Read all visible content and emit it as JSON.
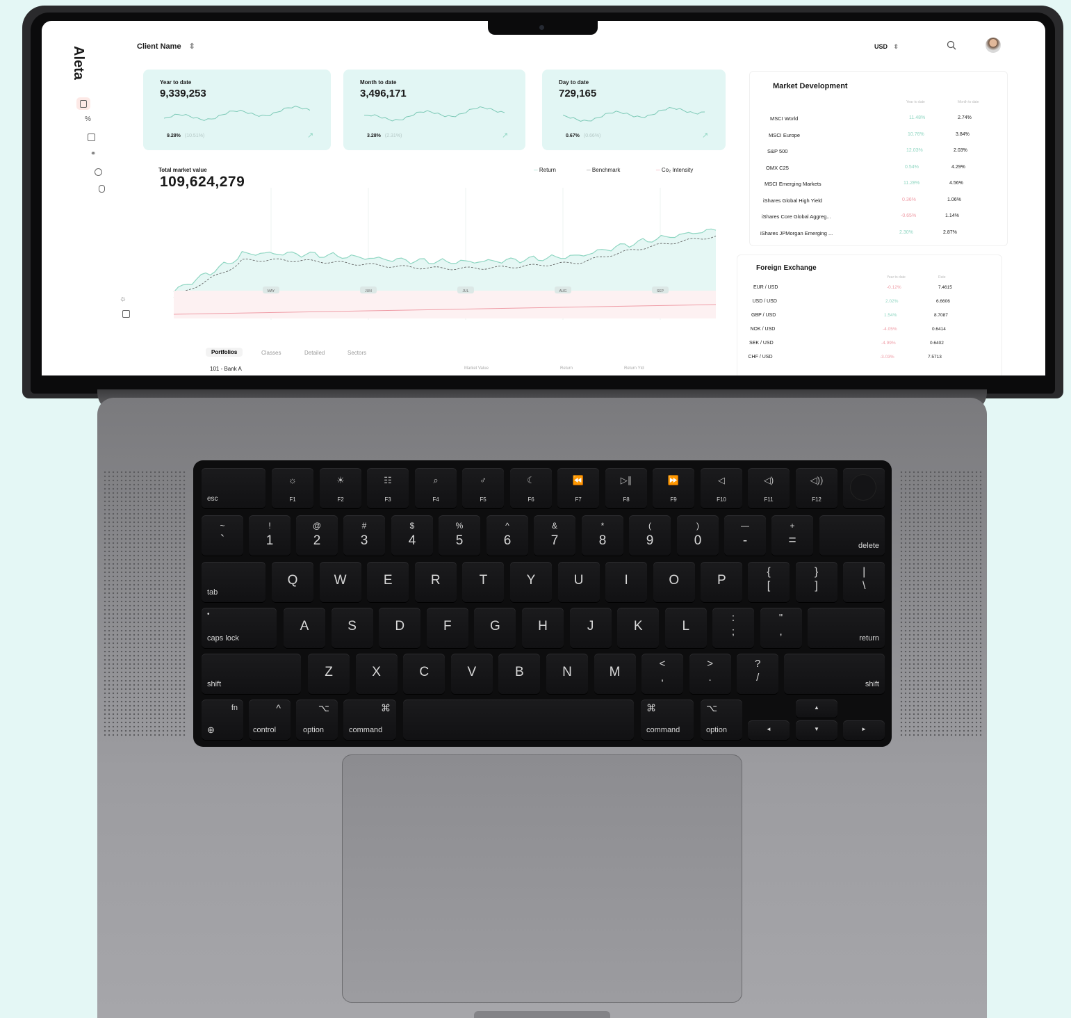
{
  "app": {
    "logo": "Aleta",
    "client_select": "Client Name",
    "currency_select": "USD",
    "search_icon": "search-icon",
    "avatar": "avatar"
  },
  "sidebar_icons": [
    "wallet-icon",
    "percent-icon",
    "calendar-icon",
    "link-icon",
    "pie-icon",
    "database-icon"
  ],
  "sidebar_bottom_icons": [
    "sun-icon",
    "logout-icon"
  ],
  "kpis": [
    {
      "label": "Year to date",
      "value": "9,339,253",
      "pct": "9.28%",
      "sub": "(10.51%)"
    },
    {
      "label": "Month to date",
      "value": "3,496,171",
      "pct": "3.28%",
      "sub": "(2.31%)"
    },
    {
      "label": "Day to date",
      "value": "729,165",
      "pct": "0.67%",
      "sub": "(0.66%)"
    }
  ],
  "total": {
    "label": "Total market value",
    "value": "109,624,279"
  },
  "legend": [
    "Return",
    "Benchmark",
    "Co₂ Intensity"
  ],
  "months": [
    "MAY",
    "JUN",
    "JUL",
    "AUG",
    "SEP"
  ],
  "tabs": [
    "Portfolios",
    "Classes",
    "Detailed",
    "Sectors"
  ],
  "portfolio_row": "101 - Bank A",
  "portfolio_cols": [
    "Market Value",
    "Return",
    "Return Ytd"
  ],
  "market": {
    "title": "Market Development",
    "cols": [
      "Year to date",
      "Month to date"
    ],
    "rows": [
      {
        "name": "MSCI World",
        "ytd": "11.48%",
        "mtd": "2.74%",
        "trend": "pos"
      },
      {
        "name": "MSCI Europe",
        "ytd": "10.76%",
        "mtd": "3.84%",
        "trend": "pos"
      },
      {
        "name": "S&P 500",
        "ytd": "12.03%",
        "mtd": "2.03%",
        "trend": "pos"
      },
      {
        "name": "OMX C25",
        "ytd": "0.54%",
        "mtd": "4.29%",
        "trend": "pos"
      },
      {
        "name": "MSCI Emerging Markets",
        "ytd": "11.28%",
        "mtd": "4.56%",
        "trend": "pos"
      },
      {
        "name": "iShares Global High Yield",
        "ytd": "0.36%",
        "mtd": "1.06%",
        "trend": "neg"
      },
      {
        "name": "iShares Core Global Aggreg...",
        "ytd": "-0.65%",
        "mtd": "1.14%",
        "trend": "neg"
      },
      {
        "name": "iShares JPMorgan Emerging ...",
        "ytd": "2.30%",
        "mtd": "2.87%",
        "trend": "pos"
      }
    ]
  },
  "fx": {
    "title": "Foreign Exchange",
    "cols": [
      "Year to date",
      "Rate"
    ],
    "rows": [
      {
        "pair": "EUR / USD",
        "ytd": "-0.12%",
        "rate": "7.4615",
        "trend": "neg"
      },
      {
        "pair": "USD / USD",
        "ytd": "2.02%",
        "rate": "6.6606",
        "trend": "pos"
      },
      {
        "pair": "GBP / USD",
        "ytd": "1.54%",
        "rate": "8.7087",
        "trend": "pos"
      },
      {
        "pair": "NOK / USD",
        "ytd": "-4.05%",
        "rate": "0.6414",
        "trend": "neg"
      },
      {
        "pair": "SEK / USD",
        "ytd": "-4.99%",
        "rate": "0.6402",
        "trend": "neg"
      },
      {
        "pair": "CHF / USD",
        "ytd": "-3.03%",
        "rate": "7.5713",
        "trend": "neg"
      }
    ]
  },
  "keyboard": {
    "fn_row": [
      {
        "main": "esc",
        "sub": ""
      },
      {
        "main": "☼",
        "sub": "F1"
      },
      {
        "main": "☀",
        "sub": "F2"
      },
      {
        "main": "☷",
        "sub": "F3"
      },
      {
        "main": "⌕",
        "sub": "F4"
      },
      {
        "main": "♂",
        "sub": "F5"
      },
      {
        "main": "☾",
        "sub": "F6"
      },
      {
        "main": "⏪",
        "sub": "F7"
      },
      {
        "main": "▷∥",
        "sub": "F8"
      },
      {
        "main": "⏩",
        "sub": "F9"
      },
      {
        "main": "◁",
        "sub": "F10"
      },
      {
        "main": "◁)",
        "sub": "F11"
      },
      {
        "main": "◁))",
        "sub": "F12"
      }
    ],
    "num_row": [
      {
        "top": "~",
        "bot": "`"
      },
      {
        "top": "!",
        "bot": "1"
      },
      {
        "top": "@",
        "bot": "2"
      },
      {
        "top": "#",
        "bot": "3"
      },
      {
        "top": "$",
        "bot": "4"
      },
      {
        "top": "%",
        "bot": "5"
      },
      {
        "top": "^",
        "bot": "6"
      },
      {
        "top": "&",
        "bot": "7"
      },
      {
        "top": "*",
        "bot": "8"
      },
      {
        "top": "(",
        "bot": "9"
      },
      {
        "top": ")",
        "bot": "0"
      },
      {
        "top": "—",
        "bot": "-"
      },
      {
        "top": "+",
        "bot": "="
      }
    ],
    "delete": "delete",
    "tab": "tab",
    "qwerty": [
      "Q",
      "W",
      "E",
      "R",
      "T",
      "Y",
      "U",
      "I",
      "O",
      "P"
    ],
    "brackets": [
      {
        "top": "{",
        "bot": "["
      },
      {
        "top": "}",
        "bot": "]"
      },
      {
        "top": "|",
        "bot": "\\"
      }
    ],
    "caps": "caps lock",
    "caps_dot": "•",
    "asdf": [
      "A",
      "S",
      "D",
      "F",
      "G",
      "H",
      "J",
      "K",
      "L"
    ],
    "semi": [
      {
        "top": ":",
        "bot": ";"
      },
      {
        "top": "\"",
        "bot": ","
      }
    ],
    "return": "return",
    "shift": "shift",
    "zxcv": [
      "Z",
      "X",
      "C",
      "V",
      "B",
      "N",
      "M"
    ],
    "punct": [
      {
        "top": "<",
        "bot": ","
      },
      {
        "top": ">",
        "bot": "."
      },
      {
        "top": "?",
        "bot": "/"
      }
    ],
    "bottom": {
      "fn": "fn",
      "globe": "⊕",
      "control": "control",
      "control_sym": "^",
      "option": "option",
      "option_sym": "⌥",
      "command": "command",
      "command_sym": "⌘"
    },
    "arrows": {
      "up": "▲",
      "down": "▼",
      "left": "◄",
      "right": "►"
    }
  }
}
